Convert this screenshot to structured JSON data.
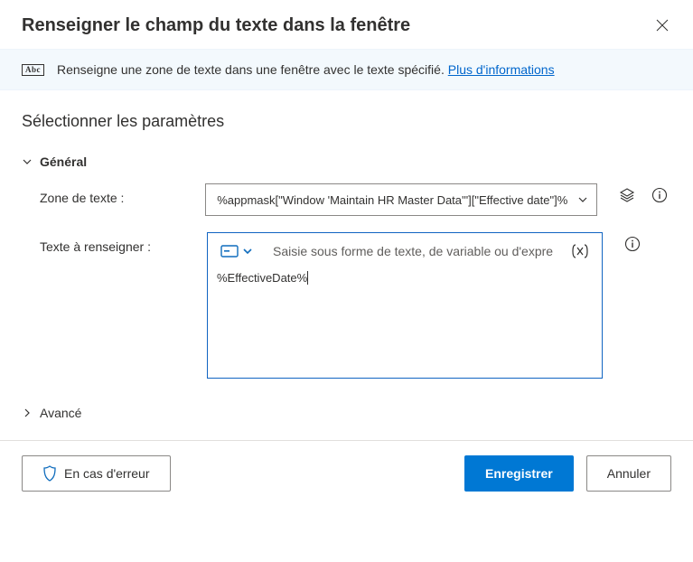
{
  "header": {
    "title": "Renseigner le champ du texte dans la fenêtre"
  },
  "banner": {
    "badge": "Abc",
    "text": "Renseigne une zone de texte dans une fenêtre avec le texte spécifié. ",
    "link": "Plus d'informations"
  },
  "section": {
    "title": "Sélectionner les paramètres",
    "general": "Général",
    "advanced": "Avancé"
  },
  "fields": {
    "zone": {
      "label": "Zone de texte :",
      "value": "%appmask[\"Window 'Maintain HR Master Data'\"][\"Effective date\"]%"
    },
    "text": {
      "label": "Texte à renseigner :",
      "placeholder": "Saisie sous forme de texte, de variable ou d'expre",
      "value": "%EffectiveDate%"
    }
  },
  "footer": {
    "error": "En cas d'erreur",
    "save": "Enregistrer",
    "cancel": "Annuler"
  }
}
